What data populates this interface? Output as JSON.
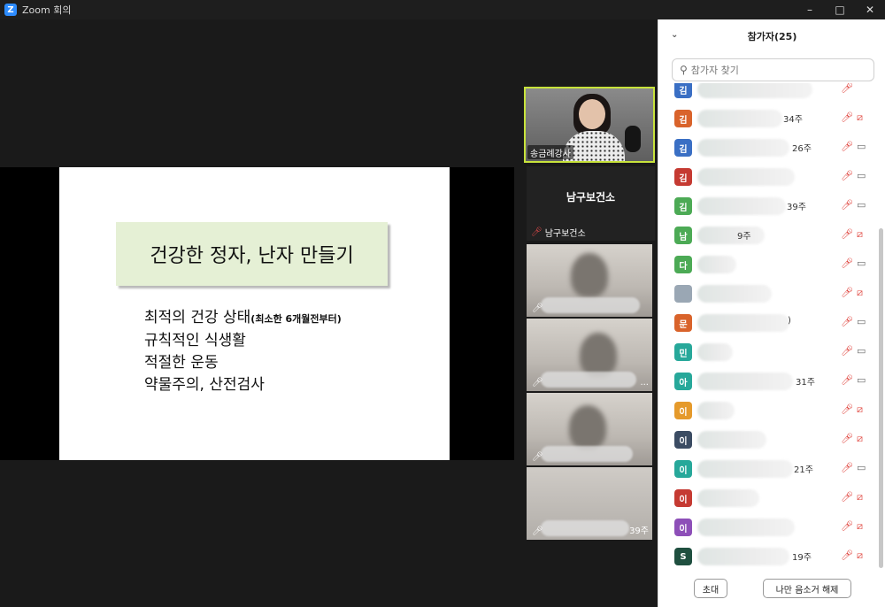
{
  "window": {
    "app_icon": "zoom-icon",
    "title": "Zoom 회의",
    "controls": [
      "minimize-icon",
      "maximize-icon",
      "close-icon"
    ]
  },
  "slide": {
    "title": "건강한 정자, 난자 만들기",
    "bullets": [
      {
        "text": "최적의 건강 상태",
        "note": "(최소한 6개월전부터)"
      },
      {
        "text": "규칙적인 식생활",
        "note": ""
      },
      {
        "text": "적절한 운동",
        "note": ""
      },
      {
        "text": "약물주의, 산전검사",
        "note": ""
      }
    ]
  },
  "gallery": {
    "active_speaker_label": "송금례강사",
    "name_card_title": "남구보건소",
    "name_card_label": "남구보건소",
    "tile_suffixes": [
      "",
      "...",
      "",
      "39주"
    ]
  },
  "participants": {
    "title": "참가자(25)",
    "search_placeholder": "참가자 찾기",
    "rows": [
      {
        "initial": "김",
        "color": "#3a6fc4",
        "suffix": "",
        "cam": "none"
      },
      {
        "initial": "김",
        "color": "#d9632b",
        "suffix": "34주",
        "cam": "off"
      },
      {
        "initial": "김",
        "color": "#3a6fc4",
        "suffix": "26주",
        "cam": "on"
      },
      {
        "initial": "김",
        "color": "#c53a32",
        "suffix": "",
        "cam": "on"
      },
      {
        "initial": "김",
        "color": "#4caa55",
        "suffix": "39주",
        "cam": "on"
      },
      {
        "initial": "남",
        "color": "#4caa55",
        "suffix": "9주",
        "cam": "off"
      },
      {
        "initial": "다",
        "color": "#4caa55",
        "suffix": "",
        "cam": "on"
      },
      {
        "initial": "",
        "color": "#9aa7b4",
        "suffix": "",
        "cam": "off"
      },
      {
        "initial": "문",
        "color": "#d9632b",
        "suffix": ")",
        "cam": "on"
      },
      {
        "initial": "민",
        "color": "#27a89a",
        "suffix": "",
        "cam": "on"
      },
      {
        "initial": "아",
        "color": "#27a89a",
        "suffix": "31주",
        "cam": "on"
      },
      {
        "initial": "이",
        "color": "#e59a2b",
        "suffix": "",
        "cam": "off"
      },
      {
        "initial": "이",
        "color": "#3b4c63",
        "suffix": "",
        "cam": "off"
      },
      {
        "initial": "이",
        "color": "#27a89a",
        "suffix": "21주",
        "cam": "on"
      },
      {
        "initial": "이",
        "color": "#c53a32",
        "suffix": "",
        "cam": "off"
      },
      {
        "initial": "이",
        "color": "#8d4fb8",
        "suffix": "",
        "cam": "off"
      },
      {
        "initial": "S",
        "color": "#1f4f3f",
        "suffix": "19주",
        "cam": "off"
      }
    ],
    "invite_label": "초대",
    "unmute_self_label": "나만 음소거 해제"
  }
}
